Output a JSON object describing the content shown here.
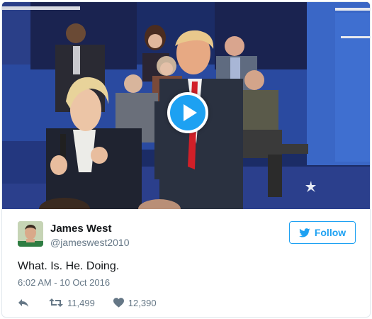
{
  "media": {
    "type": "video",
    "play_icon": "play-icon"
  },
  "tweet": {
    "author": {
      "display_name": "James West",
      "screen_name": "@jameswest2010",
      "avatar_icon": "avatar"
    },
    "follow_label": "Follow",
    "follow_icon": "twitter-bird-icon",
    "text": "What. Is. He. Doing.",
    "timestamp": "6:02 AM - 10 Oct 2016",
    "actions": {
      "reply_icon": "reply-icon",
      "retweet_icon": "retweet-icon",
      "retweet_count": "11,499",
      "like_icon": "heart-icon",
      "like_count": "12,390"
    }
  },
  "colors": {
    "accent": "#1da1f2",
    "secondary_text": "#657786",
    "primary_text": "#14171a",
    "border": "#e1e8ed"
  }
}
